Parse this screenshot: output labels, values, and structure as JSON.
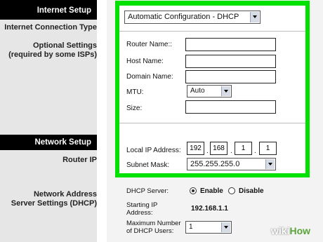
{
  "left": {
    "internet_setup_header": "Internet Setup",
    "internet_connection_type": "Internet Connection Type",
    "optional_settings_line1": "Optional Settings",
    "optional_settings_line2": "(required by some ISPs)",
    "network_setup_header": "Network Setup",
    "router_ip": "Router IP",
    "nas_line1": "Network Address",
    "nas_line2": "Server Settings (DHCP)"
  },
  "connection_type": {
    "selected": "Automatic Configuration - DHCP"
  },
  "optional": {
    "router_name_label": "Router Name::",
    "router_name_value": "",
    "host_name_label": "Host Name:",
    "host_name_value": "",
    "domain_name_label": "Domain Name:",
    "domain_name_value": "",
    "mtu_label": "MTU:",
    "mtu_selected": "Auto",
    "size_label": "Size:",
    "size_value": ""
  },
  "router_ip": {
    "local_ip_label": "Local IP Address:",
    "octets": [
      "192",
      "168",
      "1",
      "1"
    ],
    "subnet_mask_label": "Subnet Mask:",
    "subnet_mask_selected": "255.255.255.0"
  },
  "dhcp": {
    "server_label": "DHCP Server:",
    "enable_label": "Enable",
    "disable_label": "Disable",
    "enabled": true,
    "starting_ip_label_line1": "Starting IP",
    "starting_ip_label_line2": "Address:",
    "starting_ip_value": "192.168.1.1",
    "max_users_label_line1": "Maximum Number",
    "max_users_label_line2": "of DHCP Users:",
    "max_users_selected": "1"
  },
  "watermark": {
    "wiki": "wiki",
    "how": "How"
  },
  "colors": {
    "highlight": "#00e100",
    "header_bg": "#000000",
    "left_bg": "#e6e6e6"
  }
}
